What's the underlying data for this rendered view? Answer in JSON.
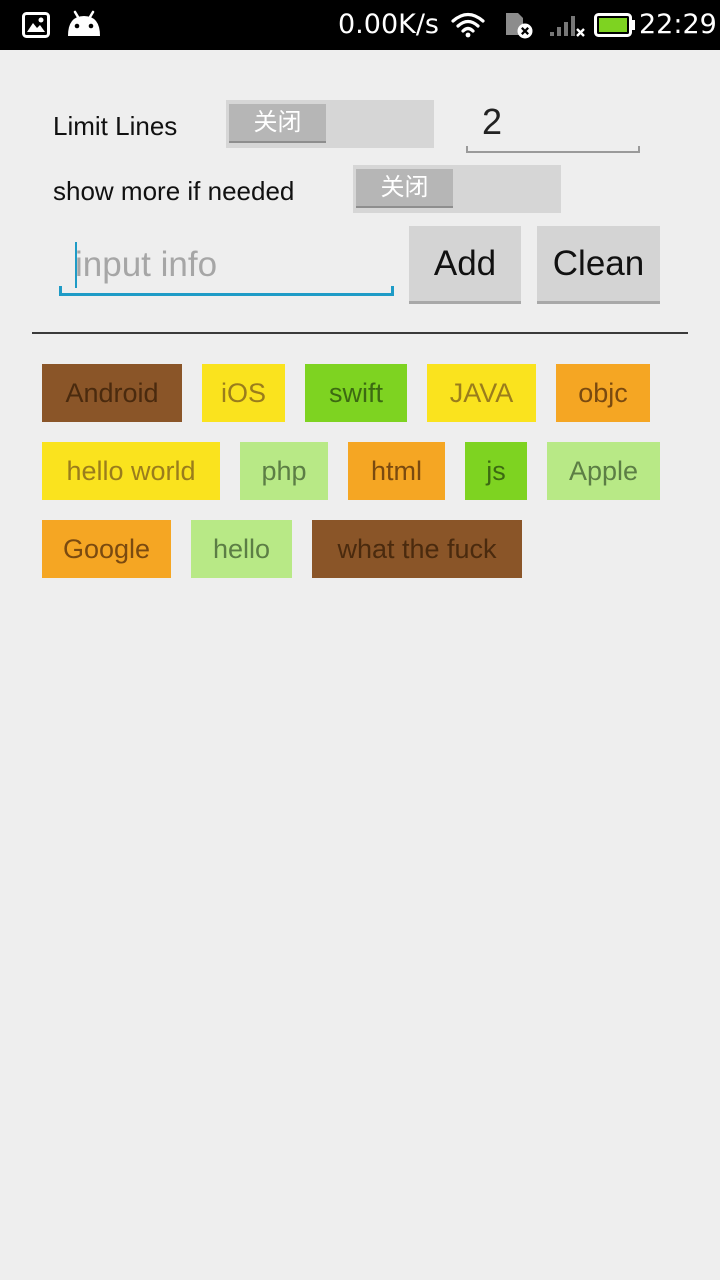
{
  "status_bar": {
    "net_speed": "0.00K/s",
    "time": "22:29",
    "icons": [
      "image-notification-icon",
      "android-notification-icon",
      "wifi-icon",
      "sim-disabled-icon",
      "signal-icon",
      "battery-icon"
    ]
  },
  "controls": {
    "limit_lines_label": "Limit Lines",
    "limit_lines_switch": "关闭",
    "limit_lines_value": "2",
    "show_more_label": "show more if needed",
    "show_more_switch": "关闭",
    "input_placeholder": "input info",
    "input_value": "",
    "add_label": "Add",
    "clean_label": "Clean"
  },
  "colors": {
    "brown": "#8A5528",
    "yellow": "#FAE31E",
    "green": "#7ED321",
    "orange": "#F5A623",
    "light_green": "#B8E986",
    "accent": "#1E9BC6"
  },
  "tags": [
    {
      "label": "Android",
      "color": "brown"
    },
    {
      "label": "iOS",
      "color": "yellow"
    },
    {
      "label": "swift",
      "color": "green"
    },
    {
      "label": "JAVA",
      "color": "yellow"
    },
    {
      "label": "objc",
      "color": "orange"
    },
    {
      "label": "hello world",
      "color": "yellow"
    },
    {
      "label": "php",
      "color": "light_green"
    },
    {
      "label": "html",
      "color": "orange"
    },
    {
      "label": "js",
      "color": "green"
    },
    {
      "label": "Apple",
      "color": "light_green"
    },
    {
      "label": "Google",
      "color": "orange"
    },
    {
      "label": "hello",
      "color": "light_green"
    },
    {
      "label": "what the fuck",
      "color": "brown"
    }
  ]
}
